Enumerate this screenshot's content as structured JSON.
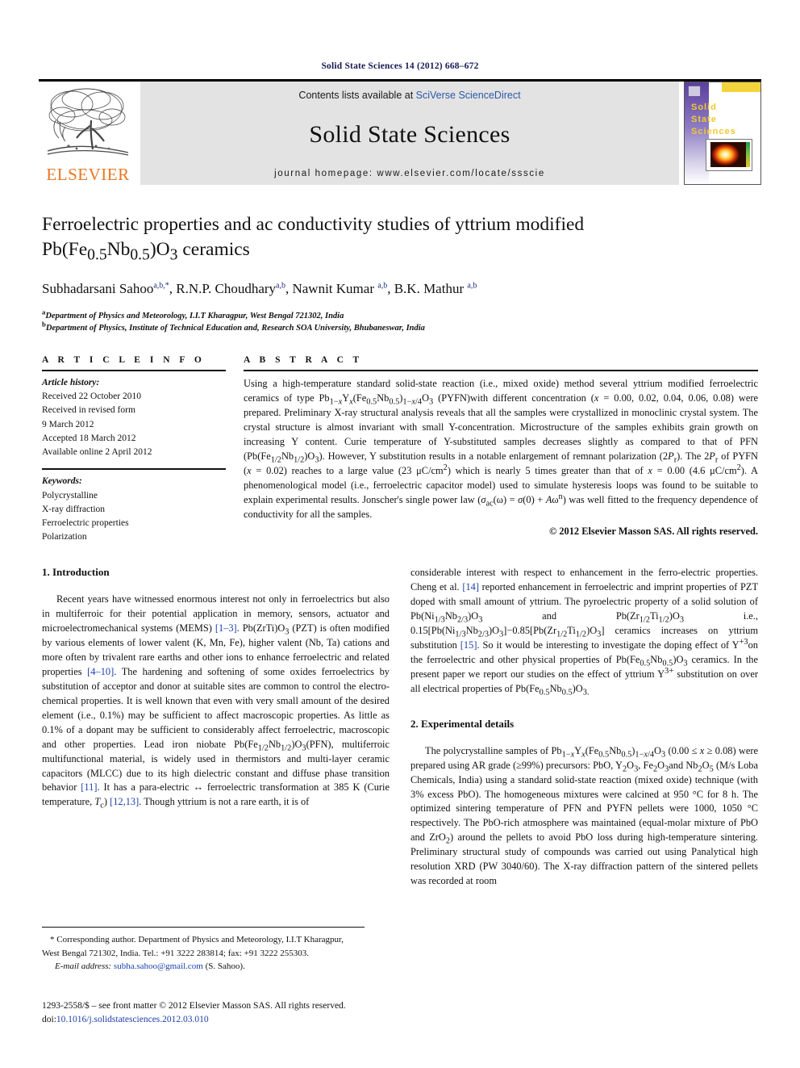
{
  "running_head": "Solid State Sciences 14 (2012) 668–672",
  "masthead": {
    "contents_prefix": "Contents lists available at ",
    "sciencedirect_link": "SciVerse ScienceDirect",
    "journal_title": "Solid State Sciences",
    "homepage": "journal homepage: www.elsevier.com/locate/ssscie",
    "publisher_wordmark": "ELSEVIER",
    "cover_title": "Solid\nState\nSciences",
    "link_color": "#2a59a8",
    "elsevier_orange": "#E87722"
  },
  "article": {
    "title_line1": "Ferroelectric properties and ac conductivity studies of yttrium modified",
    "title_formula": "Pb(Fe",
    "authors_plain": "Subhadarsani Sahoo a,b,*, R.N.P. Choudhary a,b, Nawnit Kumar a,b, B.K. Mathur a,b",
    "affiliation_a": "Department of Physics and Meteorology, I.I.T Kharagpur, West Bengal 721302, India",
    "affiliation_b": "Department of Physics, Institute of Technical Education and, Research SOA University, Bhubaneswar, India"
  },
  "info": {
    "heading": "A R T I C L E  I N F O",
    "history_label": "Article history:",
    "history": [
      "Received 22 October 2010",
      "Received in revised form",
      "9 March 2012",
      "Accepted 18 March 2012",
      "Available online 2 April 2012"
    ],
    "keywords_label": "Keywords:",
    "keywords": [
      "Polycrystalline",
      "X-ray diffraction",
      "Ferroelectric properties",
      "Polarization"
    ]
  },
  "abstract": {
    "heading": "A B S T R A C T",
    "copyright": "© 2012 Elsevier Masson SAS. All rights reserved."
  },
  "sections": {
    "intro_heading": "1.  Introduction",
    "experimental_heading": "2.  Experimental details"
  },
  "footnote": {
    "line1": "* Corresponding author. Department of Physics and Meteorology, I.I.T Kharagpur,",
    "line2": "West Bengal 721302, India. Tel.: +91 3222 283814; fax: +91 3222 255303.",
    "email_label": "E-mail address:",
    "email": "subha.sahoo@gmail.com",
    "email_suffix": " (S. Sahoo)."
  },
  "imprint": {
    "line1": "1293-2558/$ – see front matter © 2012 Elsevier Masson SAS. All rights reserved.",
    "doi_label": "doi:",
    "doi": "10.1016/j.solidstatesciences.2012.03.010"
  }
}
